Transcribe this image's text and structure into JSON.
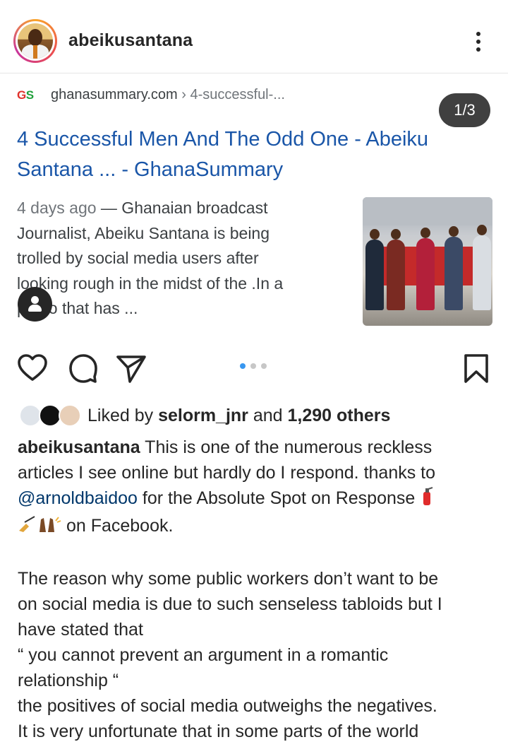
{
  "header": {
    "username": "abeikusantana",
    "avatar_icon": "profile-avatar",
    "more_icon": "more-vertical-icon"
  },
  "media": {
    "source_logo": {
      "g": "G",
      "s": "S"
    },
    "source_domain": "ghanasummary.com",
    "source_crumb": " › 4-successful-...",
    "counter": "1/3",
    "title_line1": "4 Successful Men And The Odd One - Abeiku",
    "title_line2": "Santana ... - GhanaSummary",
    "snippet_date": "4 days ago",
    "snippet_line1_rest": " — Ghanaian broadcast",
    "snippet_line2": "Journalist, Abeiku Santana is being",
    "snippet_line3": "trolled by social media users after",
    "snippet_line4": "looking rough in the midst of the .In a",
    "snippet_line5": "photo that has ...",
    "tag_icon": "user-tag-icon",
    "carousel_index": 1,
    "carousel_total": 3
  },
  "actions": {
    "like_icon": "heart-icon",
    "comment_icon": "comment-icon",
    "share_icon": "send-icon",
    "save_icon": "bookmark-icon"
  },
  "likes": {
    "prefix": "Liked by ",
    "user": "selorm_jnr",
    "middle": " and ",
    "others": "1,290 others"
  },
  "caption": {
    "username": "abeikusantana",
    "line1": " This is one of the numerous reckless",
    "line2": "articles I see online but hardly do I respond.  thanks to",
    "mention": "@arnoldbaidoo",
    "line3_rest": " for the Absolute Spot on Response ",
    "line4": " on Facebook.",
    "line5": "The reason why some public workers don’t want to be",
    "line6": "on social media is due to such senseless tabloids but I",
    "line7": "have stated that",
    "line8": "“ you cannot prevent an argument in a romantic",
    "line9": "relationship “",
    "line10": "the positives of social media outweighs the negatives.",
    "line11": "It is very unfortunate that in some parts of the world",
    "emoji_1": "fire-extinguisher-emoji",
    "emoji_2": "writing-hand-emoji",
    "emoji_3": "raised-hands-emoji"
  },
  "colors": {
    "link_blue": "#1a56a8",
    "mention_blue": "#00376b",
    "dot_active": "#3897f0",
    "dot_inactive": "#c7c7c7",
    "text": "#262626"
  }
}
